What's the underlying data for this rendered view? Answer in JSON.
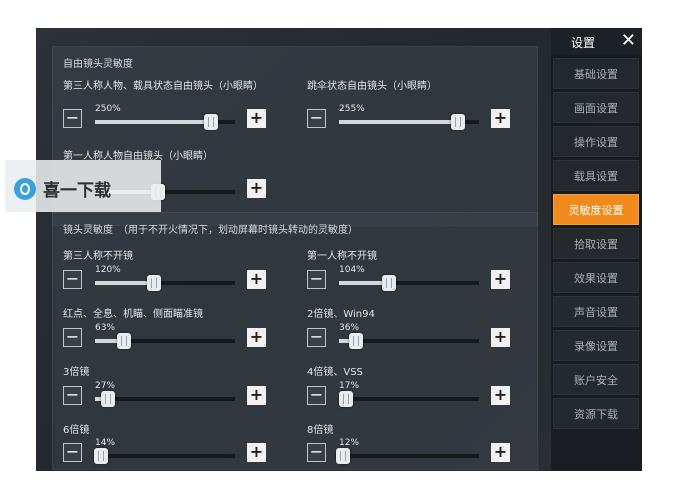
{
  "sidebar": {
    "title": "设置",
    "close_icon": "close-icon",
    "items": [
      {
        "label": "基础设置",
        "active": false
      },
      {
        "label": "画面设置",
        "active": false
      },
      {
        "label": "操作设置",
        "active": false
      },
      {
        "label": "载具设置",
        "active": false
      },
      {
        "label": "灵敏度设置",
        "active": true
      },
      {
        "label": "拾取设置",
        "active": false
      },
      {
        "label": "效果设置",
        "active": false
      },
      {
        "label": "声音设置",
        "active": false
      },
      {
        "label": "录像设置",
        "active": false
      },
      {
        "label": "账户安全",
        "active": false
      },
      {
        "label": "资源下载",
        "active": false
      }
    ],
    "accent_color": "#f08a1c"
  },
  "free_camera": {
    "title": "自由镜头灵敏度",
    "third_person": {
      "label": "第三人称人物、载具状态自由镜头（小眼睛）",
      "value": "250%",
      "level": 0.83
    },
    "parachute": {
      "label": "跳伞状态自由镜头（小眼睛）",
      "value": "255%",
      "level": 0.85
    },
    "first_person": {
      "label": "第一人称人物自由镜头（小眼睛）",
      "value": "",
      "level": 0.45
    }
  },
  "camera_sens": {
    "title": "镜头灵敏度　（用于不开火情况下，划动屏幕时镜头转动的灵敏度）",
    "third_no_scope": {
      "label": "第三人称不开镜",
      "value": "120%",
      "level": 0.42
    },
    "first_no_scope": {
      "label": "第一人称不开镜",
      "value": "104%",
      "level": 0.36
    },
    "red_dot": {
      "label": "红点、全息、机瞄、侧面瞄准镜",
      "value": "63%",
      "level": 0.21
    },
    "scope_2x": {
      "label": "2倍镜、Win94",
      "value": "36%",
      "level": 0.12
    },
    "scope_3x": {
      "label": "3倍镜",
      "value": "27%",
      "level": 0.09
    },
    "scope_4x": {
      "label": "4倍镜、VSS",
      "value": "17%",
      "level": 0.05
    },
    "scope_6x": {
      "label": "6倍镜",
      "value": "14%",
      "level": 0.04
    },
    "scope_8x": {
      "label": "8倍镜",
      "value": "12%",
      "level": 0.03
    }
  },
  "controls": {
    "minus": "−",
    "plus": "+"
  },
  "watermark": {
    "text": "喜一下载",
    "icon": "logo-icon"
  }
}
